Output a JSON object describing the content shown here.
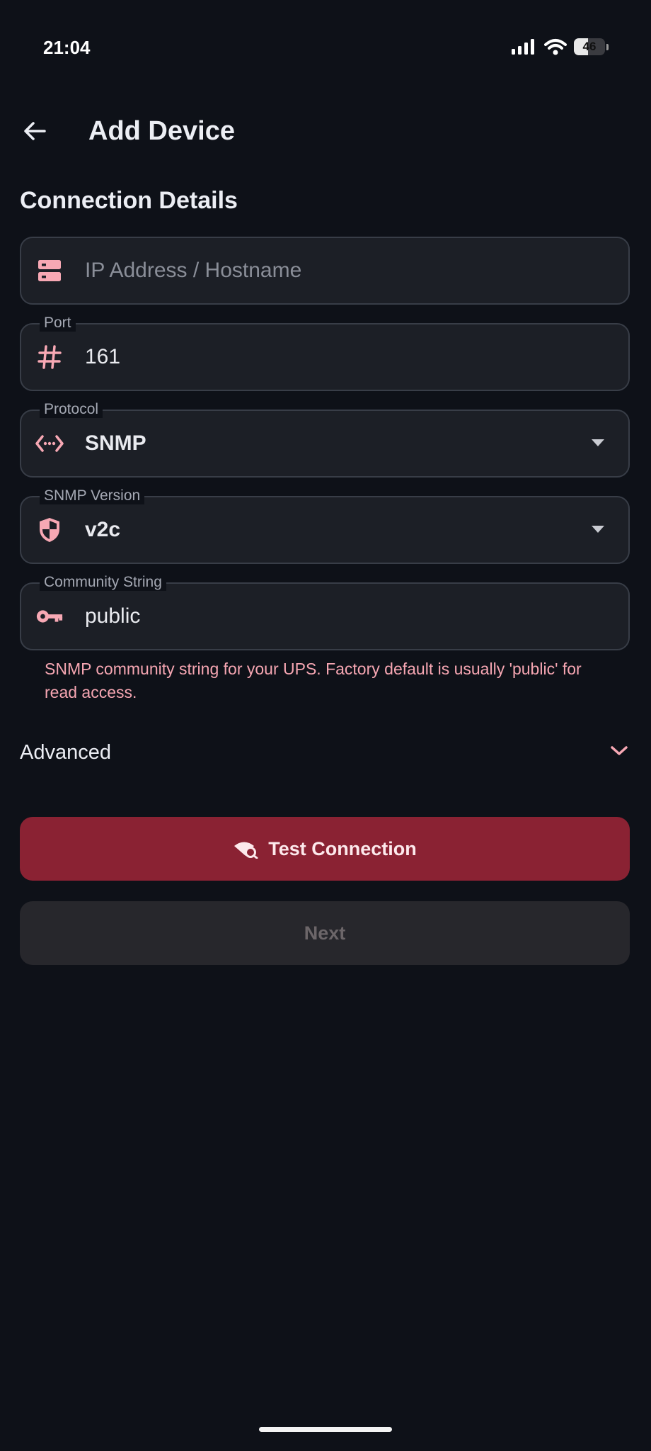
{
  "status_bar": {
    "time": "21:04",
    "battery": "46"
  },
  "header": {
    "title": "Add Device"
  },
  "section": {
    "title": "Connection Details"
  },
  "fields": {
    "host": {
      "placeholder": "IP Address / Hostname",
      "value": ""
    },
    "port": {
      "label": "Port",
      "value": "161"
    },
    "protocol": {
      "label": "Protocol",
      "value": "SNMP"
    },
    "snmp_version": {
      "label": "SNMP Version",
      "value": "v2c"
    },
    "community": {
      "label": "Community String",
      "value": "public"
    }
  },
  "helper_text": "SNMP community string for your UPS. Factory default is usually 'public' for read access.",
  "advanced": {
    "label": "Advanced"
  },
  "buttons": {
    "test": "Test Connection",
    "next": "Next"
  },
  "colors": {
    "accent": "#f7a8b4",
    "primary_button": "#8a2233",
    "background": "#0e1118"
  }
}
